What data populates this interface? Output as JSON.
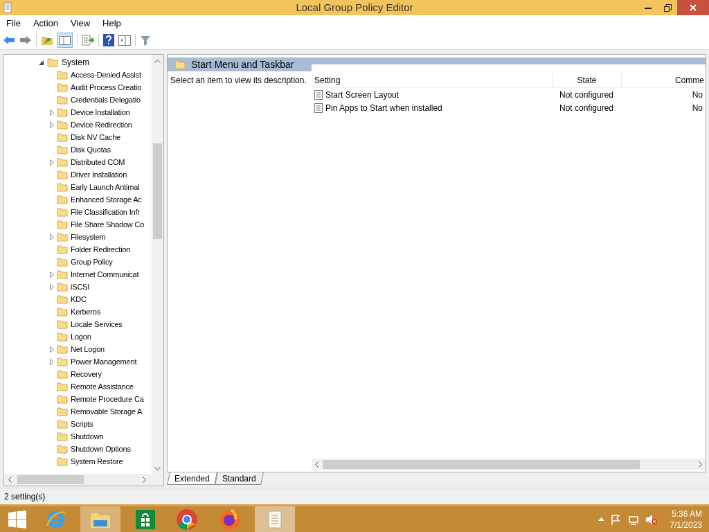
{
  "window": {
    "title": "Local Group Policy Editor"
  },
  "menu": [
    "File",
    "Action",
    "View",
    "Help"
  ],
  "tree": {
    "label": "System",
    "expanded": true,
    "children": [
      {
        "label": "Access-Denied Assist",
        "expandable": false
      },
      {
        "label": "Audit Process Creatio",
        "expandable": false
      },
      {
        "label": "Credentials Delegatio",
        "expandable": false
      },
      {
        "label": "Device Installation",
        "expandable": true
      },
      {
        "label": "Device Redirection",
        "expandable": true
      },
      {
        "label": "Disk NV Cache",
        "expandable": false
      },
      {
        "label": "Disk Quotas",
        "expandable": false
      },
      {
        "label": "Distributed COM",
        "expandable": true
      },
      {
        "label": "Driver Installation",
        "expandable": false
      },
      {
        "label": "Early Launch Antimal",
        "expandable": false
      },
      {
        "label": "Enhanced Storage Ac",
        "expandable": false
      },
      {
        "label": "File Classification Infr",
        "expandable": false
      },
      {
        "label": "File Share Shadow Co",
        "expandable": false
      },
      {
        "label": "Filesystem",
        "expandable": true
      },
      {
        "label": "Folder Redirection",
        "expandable": false
      },
      {
        "label": "Group Policy",
        "expandable": false
      },
      {
        "label": "Internet Communicat",
        "expandable": true
      },
      {
        "label": "iSCSI",
        "expandable": true
      },
      {
        "label": "KDC",
        "expandable": false
      },
      {
        "label": "Kerberos",
        "expandable": false
      },
      {
        "label": "Locale Services",
        "expandable": false
      },
      {
        "label": "Logon",
        "expandable": false
      },
      {
        "label": "Net Logon",
        "expandable": true
      },
      {
        "label": "Power Management",
        "expandable": true
      },
      {
        "label": "Recovery",
        "expandable": false
      },
      {
        "label": "Remote Assistance",
        "expandable": false
      },
      {
        "label": "Remote Procedure Ca",
        "expandable": false
      },
      {
        "label": "Removable Storage A",
        "expandable": false
      },
      {
        "label": "Scripts",
        "expandable": false
      },
      {
        "label": "Shutdown",
        "expandable": false
      },
      {
        "label": "Shutdown Options",
        "expandable": false
      },
      {
        "label": "System Restore",
        "expandable": false
      }
    ]
  },
  "details": {
    "title": "Start Menu and Taskbar",
    "description": "Select an item to view its description.",
    "columns": [
      "Setting",
      "State",
      "Comme"
    ],
    "rows": [
      {
        "setting": "Start Screen Layout",
        "state": "Not configured",
        "comment": "No"
      },
      {
        "setting": "Pin Apps to Start when installed",
        "state": "Not configured",
        "comment": "No"
      }
    ]
  },
  "tabs": [
    {
      "label": "Extended",
      "selected": true
    },
    {
      "label": "Standard",
      "selected": false
    }
  ],
  "status_bar": "2 setting(s)",
  "taskbar": {
    "time": "5:36 AM",
    "date": "7/1/2023"
  }
}
